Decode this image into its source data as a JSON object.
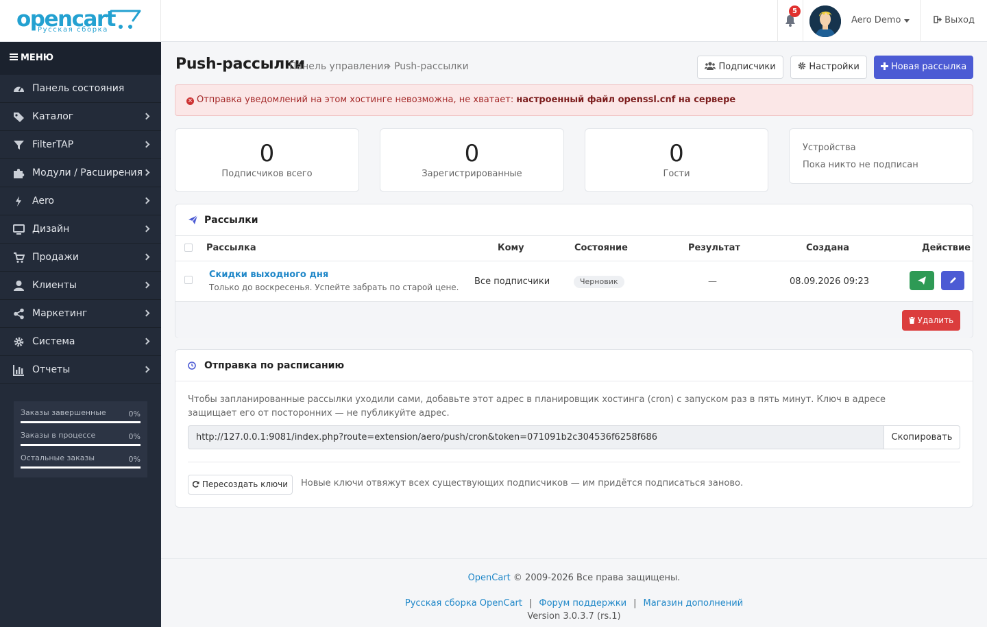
{
  "logo": {
    "name": "opencart",
    "tagline": "Русская сборка"
  },
  "header": {
    "notification_count": "5",
    "user_name": "Aero Demo",
    "logout_label": "Выход"
  },
  "sidebar": {
    "menu_label": "МЕНЮ",
    "items": [
      {
        "label": "Панель состояния",
        "icon": "dashboard-icon"
      },
      {
        "label": "Каталог",
        "icon": "tags-icon"
      },
      {
        "label": "FilterTAP",
        "icon": "filter-icon"
      },
      {
        "label": "Модули / Расширения",
        "icon": "puzzle-icon"
      },
      {
        "label": "Aero",
        "icon": "bolt-icon"
      },
      {
        "label": "Дизайн",
        "icon": "monitor-icon"
      },
      {
        "label": "Продажи",
        "icon": "cart-icon"
      },
      {
        "label": "Клиенты",
        "icon": "user-icon"
      },
      {
        "label": "Маркетинг",
        "icon": "share-icon"
      },
      {
        "label": "Система",
        "icon": "gear-icon"
      },
      {
        "label": "Отчеты",
        "icon": "bar-chart-icon"
      }
    ],
    "stats": [
      {
        "label": "Заказы завершенные",
        "value": "0%",
        "progress": 0
      },
      {
        "label": "Заказы в процессе",
        "value": "0%",
        "progress": 0
      },
      {
        "label": "Остальные заказы",
        "value": "0%",
        "progress": 0
      }
    ]
  },
  "page": {
    "title": "Push-рассылки",
    "breadcrumb": [
      "Панель управления",
      "Push-рассылки"
    ],
    "btn_subscribers": "Подписчики",
    "btn_settings": "Настройки",
    "btn_new": "Новая рассылка"
  },
  "alert": {
    "text": "Отправка уведомлений на этом хостинге невозможна, не хватает:",
    "bold": "настроенный файл openssl.cnf на сервере"
  },
  "stats_cards": [
    {
      "value": "0",
      "label": "Подписчиков всего"
    },
    {
      "value": "0",
      "label": "Зарегистрированные"
    },
    {
      "value": "0",
      "label": "Гости"
    }
  ],
  "devices": {
    "title": "Устройства",
    "text": "Пока никто не подписан"
  },
  "campaigns": {
    "title": "Рассылки",
    "columns": [
      "Рассылка",
      "Кому",
      "Состояние",
      "Результат",
      "Создана",
      "Действие"
    ],
    "rows": [
      {
        "name": "Скидки выходного дня",
        "description": "Только до воскресенья. Успейте забрать по старой цене.",
        "to": "Все подписчики",
        "status": "Черновик",
        "result": "—",
        "created": "08.09.2026 09:23"
      }
    ],
    "delete_label": "Удалить"
  },
  "schedule": {
    "title": "Отправка по расписанию",
    "description": "Чтобы запланированные рассылки уходили сами, добавьте этот адрес в планировщик хостинга (cron) с запуском раз в пять минут. Ключ в адресе защищает его от посторонних — не публикуйте адрес.",
    "url": "http://127.0.0.1:9081/index.php?route=extension/aero/push/cron&token=071091b2c304536f6258f686",
    "copy_label": "Скопировать",
    "regen_label": "Пересоздать ключи",
    "regen_note": "Новые ключи отвяжут всех существующих подписчиков — им придётся подписаться заново."
  },
  "footer": {
    "brand": "OpenCart",
    "copyright": "© 2009-2026 Все права защищены.",
    "links": [
      "Русская сборка OpenCart",
      "Форум поддержки",
      "Магазин дополнений"
    ],
    "version": "Version 3.0.3.7 (rs.1)"
  },
  "colors": {
    "primary": "#4c5bd4",
    "success": "#2e9a55",
    "danger": "#db3d3d",
    "link": "#1f87c8",
    "sidebar": "#232b39"
  }
}
